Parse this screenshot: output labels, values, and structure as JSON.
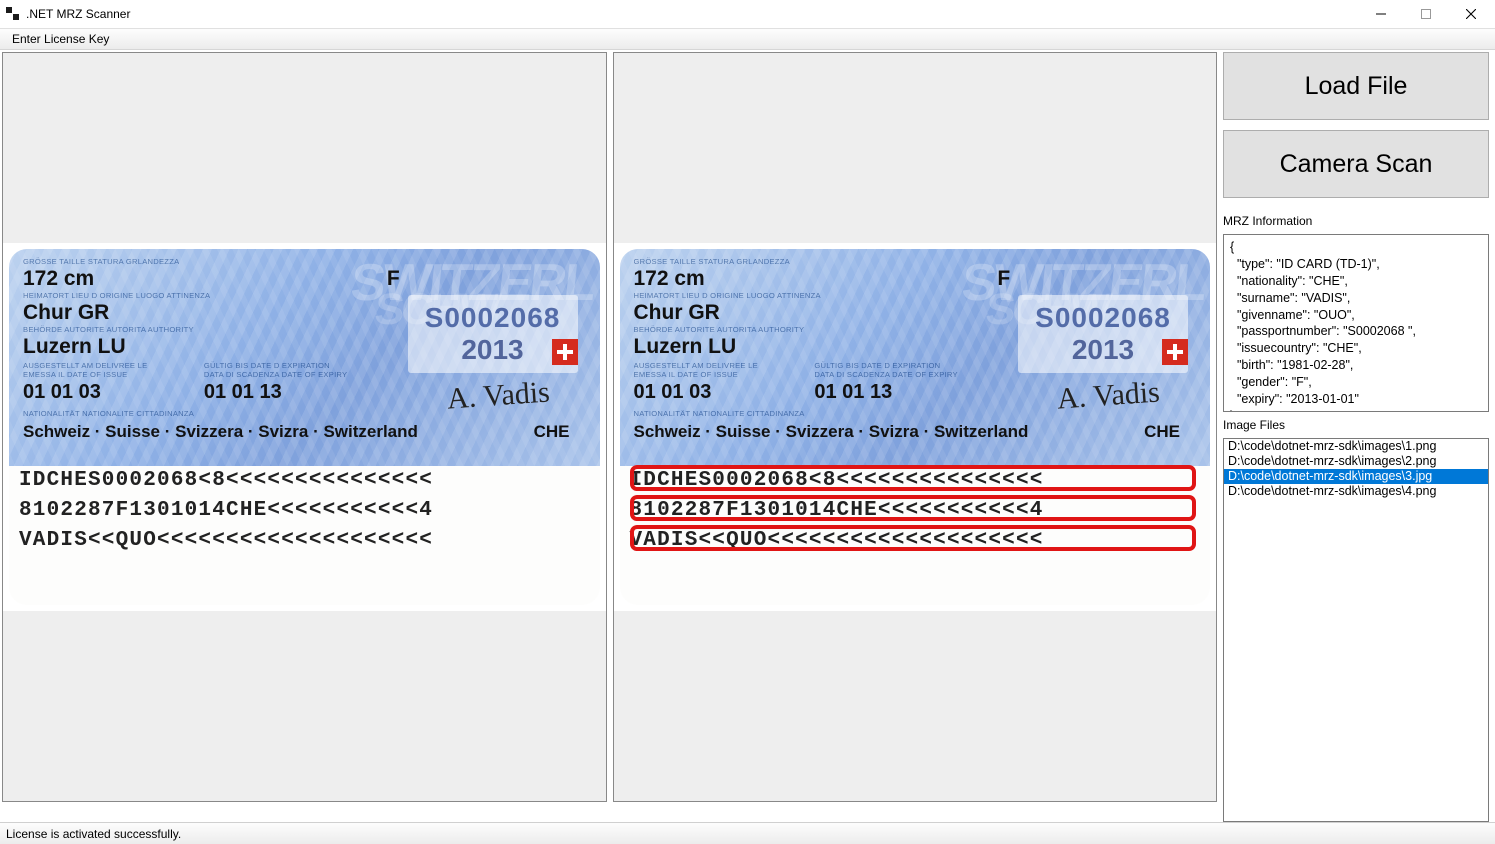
{
  "window": {
    "title": ".NET MRZ Scanner"
  },
  "menu": {
    "enter_license": "Enter License Key"
  },
  "statusbar": {
    "text": "License is activated successfully."
  },
  "buttons": {
    "load_file": "Load File",
    "camera_scan": "Camera Scan"
  },
  "mrz_section": {
    "label": "MRZ Information",
    "text": "{\n  \"type\": \"ID CARD (TD-1)\",\n  \"nationality\": \"CHE\",\n  \"surname\": \"VADIS\",\n  \"givenname\": \"OUO\",\n  \"passportnumber\": \"S0002068 \",\n  \"issuecountry\": \"CHE\",\n  \"birth\": \"1981-02-28\",\n  \"gender\": \"F\",\n  \"expiry\": \"2013-01-01\"\n}"
  },
  "image_files": {
    "label": "Image Files",
    "items": [
      {
        "path": "D:\\code\\dotnet-mrz-sdk\\images\\1.png",
        "selected": false
      },
      {
        "path": "D:\\code\\dotnet-mrz-sdk\\images\\2.png",
        "selected": false
      },
      {
        "path": "D:\\code\\dotnet-mrz-sdk\\images\\3.jpg",
        "selected": true
      },
      {
        "path": "D:\\code\\dotnet-mrz-sdk\\images\\4.png",
        "selected": false
      }
    ]
  },
  "card": {
    "height_lbl": "GRÖSSE  TAILLE  STATURA  GRLANDEZZA",
    "height": "172 cm",
    "sex_lbl": "F",
    "origin_lbl": "HEIMATORT   LIEU D ORIGINE   LUOGO ATTINENZA",
    "origin": "Chur GR",
    "authority_lbl": "BEHÖRDE   AUTORITE   AUTORITA   AUTHORITY",
    "authority": "Luzern LU",
    "issued_lbl": "AUSGESTELLT AM   DELIVREE LE",
    "issued_sub": "EMESSA IL   DATE OF ISSUE",
    "issued": "01 01 03",
    "expiry_lbl": "GÜLTIG BIS   DATE D EXPIRATION",
    "expiry_sub": "DATA DI SCADENZA   DATE OF EXPIRY",
    "expiry": "01 01 13",
    "nat_lbl": "NATIONALITÄT   NATIONALITE   CITTADINANZA",
    "nat_line": "Schweiz · Suisse · Svizzera · Svizra · Switzerland",
    "nat_code": "CHE",
    "serial": "S0002068",
    "serial_year": "2013",
    "signature": "A. Vadis",
    "mrz": {
      "l1": "IDCHES0002068<8<<<<<<<<<<<<<<<",
      "l2": "8102287F1301014CHE<<<<<<<<<<<4",
      "l3": "VADIS<<QUO<<<<<<<<<<<<<<<<<<<<"
    }
  }
}
